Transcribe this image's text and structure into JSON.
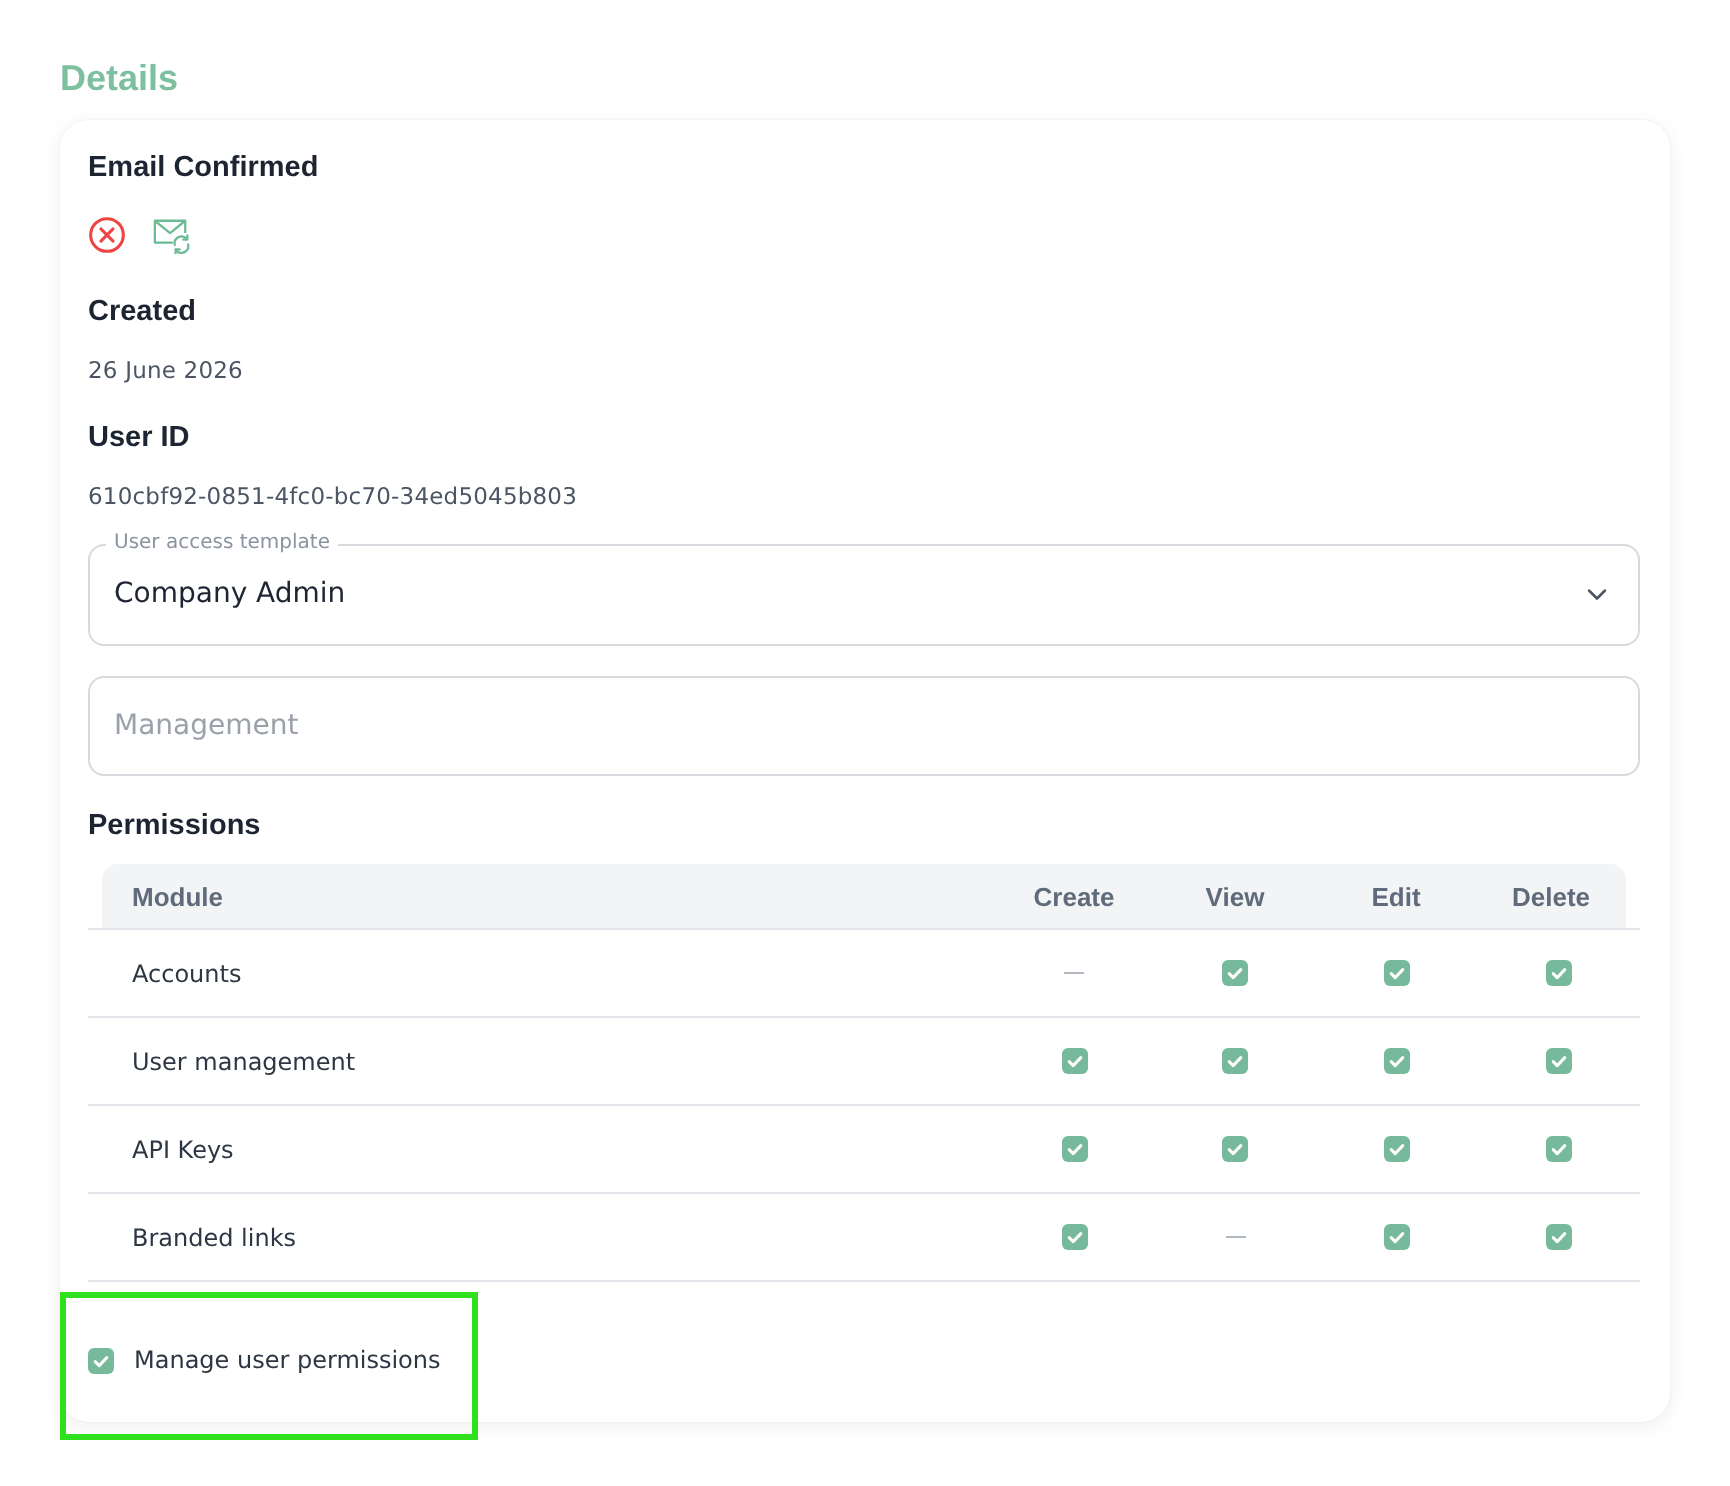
{
  "section_title": "Details",
  "email_confirmed": {
    "label": "Email Confirmed",
    "confirmed": false
  },
  "created": {
    "label": "Created",
    "value": "26 June 2026"
  },
  "user_id": {
    "label": "User ID",
    "value": "610cbf92-0851-4fc0-bc70-34ed5045b803"
  },
  "access_template": {
    "label": "User access template",
    "value": "Company Admin"
  },
  "management": {
    "placeholder": "Management"
  },
  "permissions": {
    "title": "Permissions",
    "columns": [
      "Module",
      "Create",
      "View",
      "Edit",
      "Delete"
    ],
    "rows": [
      {
        "module": "Accounts",
        "cells": [
          {
            "checked": false
          },
          {
            "checked": true
          },
          {
            "checked": true
          },
          {
            "checked": true
          }
        ]
      },
      {
        "module": "User management",
        "cells": [
          {
            "checked": true
          },
          {
            "checked": true
          },
          {
            "checked": true
          },
          {
            "checked": true
          }
        ]
      },
      {
        "module": "API Keys",
        "cells": [
          {
            "checked": true
          },
          {
            "checked": true
          },
          {
            "checked": true
          },
          {
            "checked": true
          }
        ]
      },
      {
        "module": "Branded links",
        "cells": [
          {
            "checked": true
          },
          {
            "checked": false
          },
          {
            "checked": true
          },
          {
            "checked": true
          }
        ]
      }
    ]
  },
  "manage_permissions": {
    "label": "Manage user permissions",
    "checked": true,
    "highlighted": true
  }
}
